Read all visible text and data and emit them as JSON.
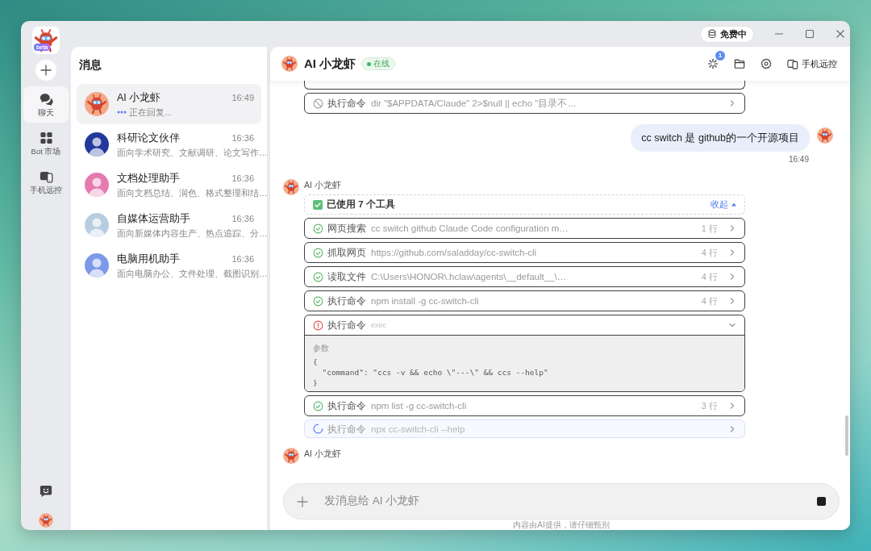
{
  "window": {
    "plan_label": "免费中"
  },
  "rail": {
    "logo_tag": "beta",
    "items": [
      {
        "kind": "chat",
        "label": "聊天",
        "selected": true
      },
      {
        "kind": "market",
        "label": "Bot 市场",
        "selected": false
      },
      {
        "kind": "remote",
        "label": "手机远控",
        "selected": false
      }
    ]
  },
  "conversations": {
    "title": "消息",
    "items": [
      {
        "kind": "mascot",
        "name": "AI 小龙虾",
        "time": "16:49",
        "preview": "正在回复...",
        "color": "#f4a886",
        "typing": true,
        "selected": true
      },
      {
        "kind": "person",
        "name": "科研论文伙伴",
        "time": "16:36",
        "preview": "面向学术研究、文献调研、论文写作…",
        "color": "#23389c",
        "typing": false,
        "selected": false
      },
      {
        "kind": "person",
        "name": "文档处理助手",
        "time": "16:36",
        "preview": "面向文档总结、润色、格式整理和结…",
        "color": "#e57aae",
        "typing": false,
        "selected": false
      },
      {
        "kind": "person",
        "name": "自媒体运营助手",
        "time": "16:36",
        "preview": "面向新媒体内容生产、热点追踪、分…",
        "color": "#b9cde0",
        "typing": false,
        "selected": false
      },
      {
        "kind": "person",
        "name": "电脑用机助手",
        "time": "16:36",
        "preview": "面向电脑办公、文件处理、截图识别…",
        "color": "#7d98e8",
        "typing": false,
        "selected": false
      }
    ]
  },
  "chat": {
    "header": {
      "title": "AI 小龙虾",
      "status": "在线",
      "online": true,
      "task_badge": "1",
      "remote_label": "手机远控"
    },
    "messages": [
      {
        "kind": "tools",
        "clipped_above": true,
        "tools": [
          {
            "kind": "blocked",
            "name": "执行命令",
            "detail": "dir \"$APPDATA/Claude\" 2>$null || echo \"目录不…",
            "expanded": false
          }
        ]
      },
      {
        "kind": "user",
        "text": "cc switch 是 github的一个开源项目",
        "time": "16:49"
      },
      {
        "kind": "assistant",
        "sender": "AI 小龙虾",
        "summary": {
          "label": "已使用 7 个工具",
          "toggle": "收起",
          "expanded": true
        },
        "tools": [
          {
            "kind": "done",
            "name": "网页搜索",
            "detail": "cc switch github Claude Code configuration m…",
            "lines": "1 行",
            "expanded": false
          },
          {
            "kind": "done",
            "name": "抓取网页",
            "detail": "https://github.com/saladday/cc-switch-cli",
            "lines": "4 行",
            "expanded": false
          },
          {
            "kind": "done",
            "name": "读取文件",
            "detail": "C:\\Users\\HONOR\\.hclaw\\agents\\__default__\\…",
            "lines": "4 行",
            "expanded": false
          },
          {
            "kind": "done",
            "name": "执行命令",
            "detail": "npm install -g cc-switch-cli",
            "lines": "4 行",
            "expanded": false
          },
          {
            "kind": "error",
            "name": "执行命令",
            "detail": "exec",
            "expanded": true,
            "params_label": "参数",
            "params": "{\n  \"command\": \"ccs -v && echo \\\"---\\\" && ccs --help\"\n}"
          },
          {
            "kind": "done",
            "name": "执行命令",
            "detail": "npm list -g cc-switch-cli",
            "lines": "3 行",
            "expanded": false
          },
          {
            "kind": "running",
            "name": "执行命令",
            "detail": "npx cc-switch-cli --help",
            "expanded": false
          }
        ]
      },
      {
        "kind": "assistant",
        "sender": "AI 小龙虾"
      }
    ]
  },
  "composer": {
    "placeholder": "发消息给 AI 小龙虾",
    "generating": true,
    "disclaimer": "内容由AI提供，请仔细甄别"
  }
}
